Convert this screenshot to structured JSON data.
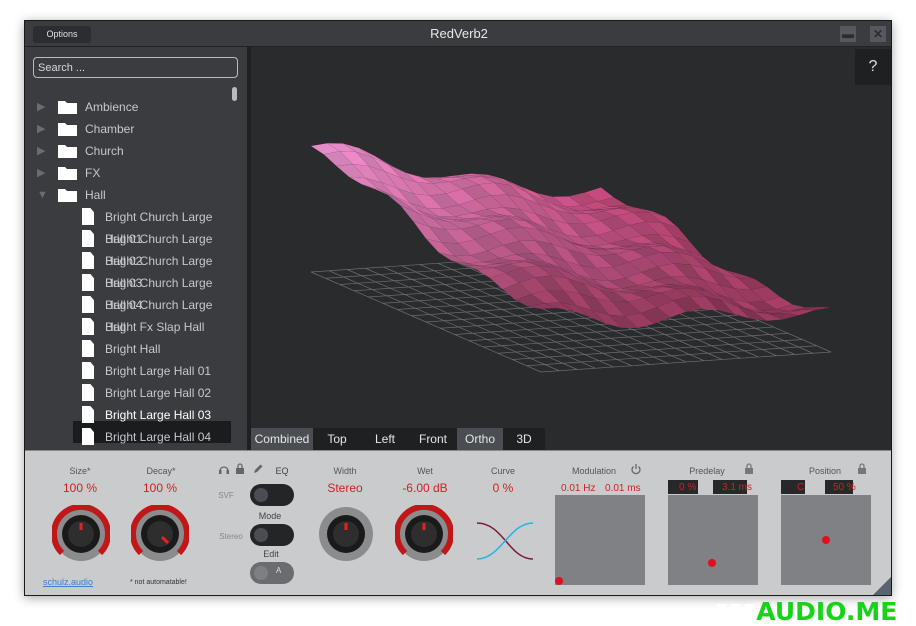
{
  "window": {
    "title": "RedVerb2",
    "options_label": "Options",
    "minimize_label": "▬",
    "close_label": "✕"
  },
  "sidebar": {
    "search_placeholder": "Search ...",
    "folders": [
      {
        "label": "Ambience",
        "expanded": false
      },
      {
        "label": "Chamber",
        "expanded": false
      },
      {
        "label": "Church",
        "expanded": false
      },
      {
        "label": "FX",
        "expanded": false
      },
      {
        "label": "Hall",
        "expanded": true
      }
    ],
    "presets": [
      "Bright Church Large Hall 01",
      "Bright Church Large Hall 02",
      "Bright Church Large Hall 03",
      "Bright Church Large Hall 04",
      "Bright Church Large Hall",
      "Bright Fx Slap Hall",
      "Bright Hall",
      "Bright Large Hall 01",
      "Bright Large Hall 02",
      "Bright Large Hall 03",
      "Bright Large Hall 04"
    ],
    "selected_preset": "Bright Large Hall 03"
  },
  "viewport": {
    "help_label": "?",
    "tabs": [
      "Combined",
      "Top",
      "Left",
      "Front",
      "Ortho",
      "3D"
    ],
    "active_tabs": [
      "Combined",
      "Ortho"
    ],
    "surface_color": "#c8477a"
  },
  "controls": {
    "size": {
      "label": "Size*",
      "value": "100 %"
    },
    "decay": {
      "label": "Decay*",
      "value": "100 %"
    },
    "eq": {
      "label": "EQ",
      "svf_label": "SVF",
      "mode_label": "Mode",
      "stereo_label": "Stereo",
      "edit_label": "Edit",
      "edit_value": "A"
    },
    "width": {
      "label": "Width",
      "value": "Stereo"
    },
    "wet": {
      "label": "Wet",
      "value": "-6.00 dB"
    },
    "curve": {
      "label": "Curve",
      "value": "0 %"
    },
    "modulation": {
      "label": "Modulation",
      "rate": "0.01 Hz",
      "depth": "0.01 ms"
    },
    "predelay": {
      "label": "Predelay",
      "value_a": "0 %",
      "value_b": "3.1 ms"
    },
    "position": {
      "label": "Position",
      "value_a": "C",
      "value_b": "50 %"
    },
    "footer_link": "schulz.audio",
    "footnote": "* not automatable!"
  },
  "watermark": "AUDIO.ME",
  "colors": {
    "accent": "#d42020",
    "green": "#18d418"
  }
}
